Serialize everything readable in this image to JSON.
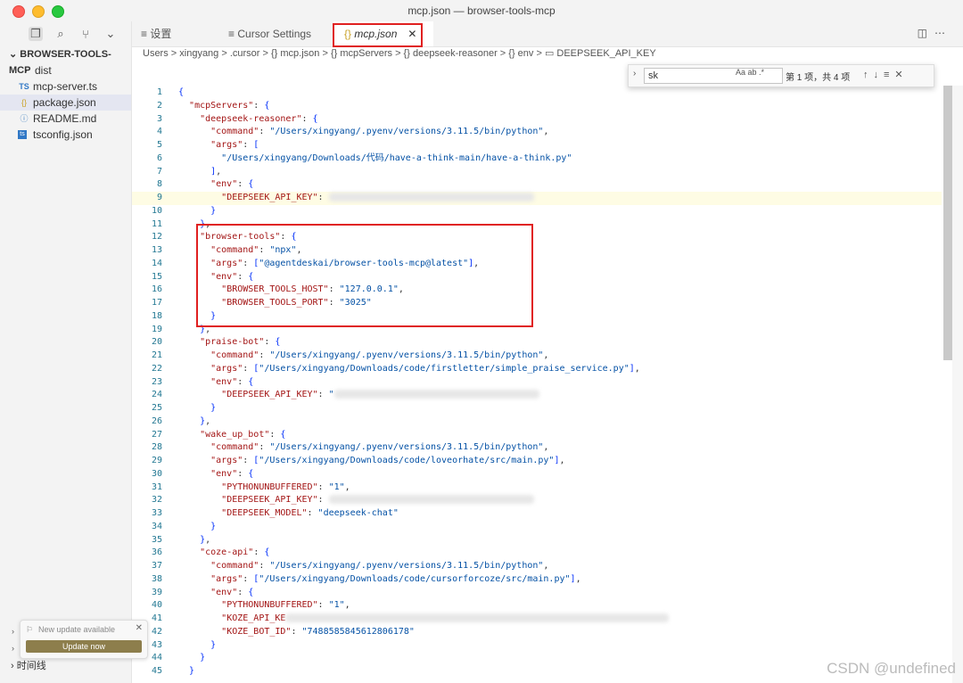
{
  "window": {
    "title": "mcp.json — browser-tools-mcp"
  },
  "sidebar": {
    "section": "BROWSER-TOOLS-MCP",
    "items": [
      {
        "label": "dist",
        "type": "folder"
      },
      {
        "label": "mcp-server.ts",
        "type": "ts",
        "prefix": "TS"
      },
      {
        "label": "package.json",
        "type": "json",
        "prefix": "{}"
      },
      {
        "label": "README.md",
        "type": "md",
        "prefix": "ⓘ"
      },
      {
        "label": "tsconfig.json",
        "type": "tsconfig",
        "prefix": "ts"
      }
    ],
    "timeline": "时间线"
  },
  "notification": {
    "text": "New update available",
    "button": "Update now"
  },
  "tabs": [
    {
      "label": "设置",
      "icon": "≡"
    },
    {
      "label": "Cursor Settings",
      "icon": "≡"
    },
    {
      "label": "mcp.json",
      "icon": "{}"
    }
  ],
  "breadcrumb": "Users > xingyang > .cursor > {} mcp.json > {} mcpServers > {} deepseek-reasoner > {} env > ▭ DEEPSEEK_API_KEY",
  "find": {
    "query": "sk",
    "options": "Aa  ab  .*",
    "count": "第 1 项，共 4 项"
  },
  "editor": {
    "lines": [
      {
        "n": "1",
        "html": "<span class='b'>{</span>"
      },
      {
        "n": "2",
        "html": "  <span class='k'>\"mcpServers\"</span>: <span class='b'>{</span>"
      },
      {
        "n": "3",
        "html": "    <span class='k'>\"deepseek-reasoner\"</span>: <span class='b'>{</span>"
      },
      {
        "n": "4",
        "html": "      <span class='k'>\"command\"</span>: <span class='s'>\"/Users/xingyang/.pyenv/versions/3.11.5/bin/python\"</span>,"
      },
      {
        "n": "5",
        "html": "      <span class='k'>\"args\"</span>: <span class='b'>[</span>"
      },
      {
        "n": "6",
        "html": "        <span class='s'>\"/Users/xingyang/Downloads/代码/have-a-think-main/have-a-think.py\"</span>"
      },
      {
        "n": "7",
        "html": "      <span class='b'>]</span>,"
      },
      {
        "n": "8",
        "html": "      <span class='k'>\"env\"</span>: <span class='b'>{</span>"
      },
      {
        "n": "9",
        "html": "        <span class='k'>\"DEEPSEEK_API_KEY\"</span>: <span class='blur'></span>"
      },
      {
        "n": "10",
        "html": "      <span class='b'>}</span>"
      },
      {
        "n": "11",
        "html": "    <span class='b'>}</span>,"
      },
      {
        "n": "12",
        "html": "    <span class='k'>\"browser-tools\"</span>: <span class='b'>{</span>"
      },
      {
        "n": "13",
        "html": "      <span class='k'>\"command\"</span>: <span class='s'>\"npx\"</span>,"
      },
      {
        "n": "14",
        "html": "      <span class='k'>\"args\"</span>: <span class='b'>[</span><span class='s'>\"@agentdeskai/browser-tools-mcp@latest\"</span><span class='b'>]</span>,"
      },
      {
        "n": "15",
        "html": "      <span class='k'>\"env\"</span>: <span class='b'>{</span>"
      },
      {
        "n": "16",
        "html": "        <span class='k'>\"BROWSER_TOOLS_HOST\"</span>: <span class='s'>\"127.0.0.1\"</span>,"
      },
      {
        "n": "17",
        "html": "        <span class='k'>\"BROWSER_TOOLS_PORT\"</span>: <span class='s'>\"3025\"</span>"
      },
      {
        "n": "18",
        "html": "      <span class='b'>}</span>"
      },
      {
        "n": "19",
        "html": "    <span class='b'>}</span>,"
      },
      {
        "n": "20",
        "html": "    <span class='k'>\"praise-bot\"</span>: <span class='b'>{</span>"
      },
      {
        "n": "21",
        "html": "      <span class='k'>\"command\"</span>: <span class='s'>\"/Users/xingyang/.pyenv/versions/3.11.5/bin/python\"</span>,"
      },
      {
        "n": "22",
        "html": "      <span class='k'>\"args\"</span>: <span class='b'>[</span><span class='s'>\"/Users/xingyang/Downloads/code/firstletter/simple_praise_service.py\"</span><span class='b'>]</span>,"
      },
      {
        "n": "23",
        "html": "      <span class='k'>\"env\"</span>: <span class='b'>{</span>"
      },
      {
        "n": "24",
        "html": "        <span class='k'>\"DEEPSEEK_API_KEY\"</span>: <span class='s'>\"</span><span class='blur'></span>"
      },
      {
        "n": "25",
        "html": "      <span class='b'>}</span>"
      },
      {
        "n": "26",
        "html": "    <span class='b'>}</span>,"
      },
      {
        "n": "27",
        "html": "    <span class='k'>\"wake_up_bot\"</span>: <span class='b'>{</span>"
      },
      {
        "n": "28",
        "html": "      <span class='k'>\"command\"</span>: <span class='s'>\"/Users/xingyang/.pyenv/versions/3.11.5/bin/python\"</span>,"
      },
      {
        "n": "29",
        "html": "      <span class='k'>\"args\"</span>: <span class='b'>[</span><span class='s'>\"/Users/xingyang/Downloads/code/loveorhate/src/main.py\"</span><span class='b'>]</span>,"
      },
      {
        "n": "30",
        "html": "      <span class='k'>\"env\"</span>: <span class='b'>{</span>"
      },
      {
        "n": "31",
        "html": "        <span class='k'>\"PYTHONUNBUFFERED\"</span>: <span class='s'>\"1\"</span>,"
      },
      {
        "n": "32",
        "html": "        <span class='k'>\"DEEPSEEK_API_KEY\"</span>: <span class='blur'></span>"
      },
      {
        "n": "33",
        "html": "        <span class='k'>\"DEEPSEEK_MODEL\"</span>: <span class='s'>\"deepseek-chat\"</span>"
      },
      {
        "n": "34",
        "html": "      <span class='b'>}</span>"
      },
      {
        "n": "35",
        "html": "    <span class='b'>}</span>,"
      },
      {
        "n": "36",
        "html": "    <span class='k'>\"coze-api\"</span>: <span class='b'>{</span>"
      },
      {
        "n": "37",
        "html": "      <span class='k'>\"command\"</span>: <span class='s'>\"/Users/xingyang/.pyenv/versions/3.11.5/bin/python\"</span>,"
      },
      {
        "n": "38",
        "html": "      <span class='k'>\"args\"</span>: <span class='b'>[</span><span class='s'>\"/Users/xingyang/Downloads/code/cursorforcoze/src/main.py\"</span><span class='b'>]</span>,"
      },
      {
        "n": "39",
        "html": "      <span class='k'>\"env\"</span>: <span class='b'>{</span>"
      },
      {
        "n": "40",
        "html": "        <span class='k'>\"PYTHONUNBUFFERED\"</span>: <span class='s'>\"1\"</span>,"
      },
      {
        "n": "41",
        "html": "        <span class='k'>\"KOZE_API_KE</span><span class='blur' style='width:430px'></span>"
      },
      {
        "n": "42",
        "html": "        <span class='k'>\"KOZE_BOT_ID\"</span>: <span class='s'>\"7488585845612806178\"</span>"
      },
      {
        "n": "43",
        "html": "      <span class='b'>}</span>"
      },
      {
        "n": "44",
        "html": "    <span class='b'>}</span>"
      },
      {
        "n": "45",
        "html": "  <span class='b'>}</span>"
      }
    ]
  },
  "watermark": "CSDN @undefined"
}
